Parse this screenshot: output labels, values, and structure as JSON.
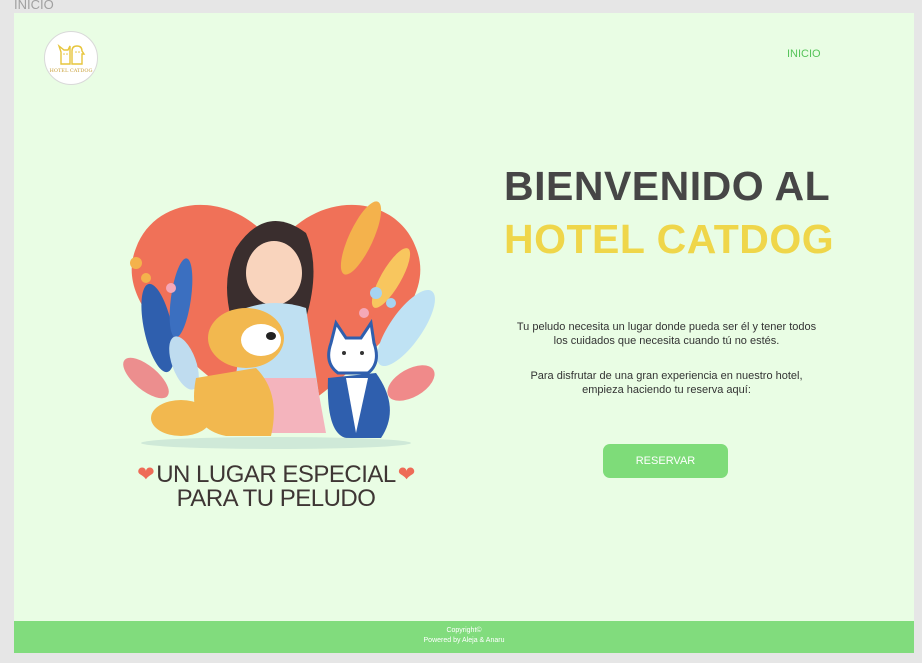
{
  "frame": {
    "label": "INICIO"
  },
  "header": {
    "logo_text": "HOTEL CATDOG",
    "nav": [
      "INICIO"
    ]
  },
  "hero": {
    "tagline_line1": "UN LUGAR ESPECIAL",
    "tagline_line2": "PARA TU PELUDO"
  },
  "main": {
    "title_line1": "BIENVENIDO AL",
    "title_line2": "HOTEL CATDOG",
    "description1": "Tu peludo necesita un lugar donde pueda ser él y tener todos los cuidados que necesita cuando tú no estés.",
    "description2": "Para disfrutar de una gran experiencia en nuestro hotel, empieza haciendo tu reserva aquí:",
    "reserve_button": "RESERVAR"
  },
  "footer": {
    "copyright": "Copyright©",
    "powered": "Powered by Aleja & Anaru"
  },
  "colors": {
    "page_bg": "#e9fde4",
    "accent_green": "#7edc79",
    "title_dark": "#464646",
    "title_yellow": "#efd64a",
    "heart": "#ee6b57"
  }
}
